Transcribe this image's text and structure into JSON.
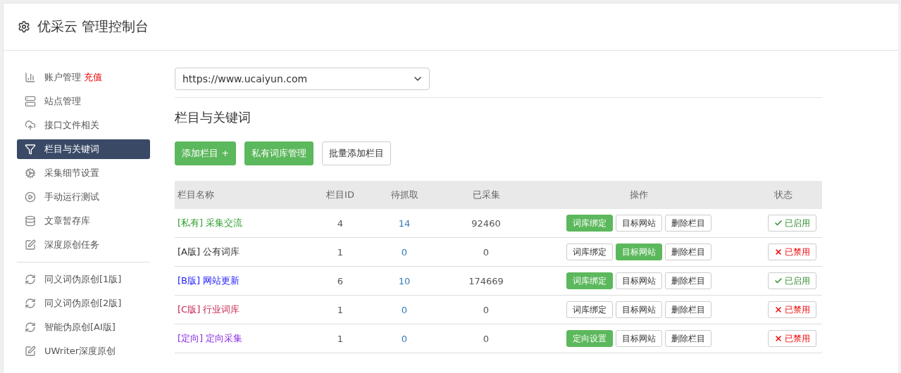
{
  "header": {
    "title": "优采云 管理控制台"
  },
  "sidebar": {
    "groups": [
      {
        "items": [
          {
            "kind": "chart",
            "label": "账户管理",
            "badge": "充值",
            "selected": false
          },
          {
            "kind": "server",
            "label": "站点管理",
            "selected": false
          },
          {
            "kind": "cloud",
            "label": "接口文件相关",
            "selected": false
          },
          {
            "kind": "filter",
            "label": "栏目与关键词",
            "selected": true
          },
          {
            "kind": "cogs",
            "label": "采集细节设置",
            "selected": false
          },
          {
            "kind": "play",
            "label": "手动运行测试",
            "selected": false
          },
          {
            "kind": "database",
            "label": "文章暂存库",
            "selected": false
          },
          {
            "kind": "edit",
            "label": "深度原创任务",
            "selected": false
          }
        ]
      },
      {
        "items": [
          {
            "kind": "refresh",
            "label": "同义词伪原创[1版]",
            "selected": false
          },
          {
            "kind": "refresh",
            "label": "同义词伪原创[2版]",
            "selected": false
          },
          {
            "kind": "refresh",
            "label": "智能伪原创[AI版]",
            "selected": false
          },
          {
            "kind": "edit",
            "label": "UWriter深度原创",
            "selected": false
          }
        ]
      }
    ]
  },
  "site_select": {
    "value": "https://www.ucaiyun.com"
  },
  "section_title": "栏目与关键词",
  "toolbar": [
    {
      "label": "添加栏目 +",
      "kind": "success"
    },
    {
      "label": "私有词库管理",
      "kind": "success"
    },
    {
      "label": "批量添加栏目",
      "kind": "default"
    }
  ],
  "table": {
    "columns": [
      "栏目名称",
      "栏目ID",
      "待抓取",
      "已采集",
      "操作",
      "状态"
    ],
    "rows": [
      {
        "name": "[私有] 采集交流",
        "color": "#2e9e2e",
        "id": "4",
        "pending": "14",
        "collected": "92460",
        "actions": [
          {
            "label": "词库绑定",
            "primary": true
          },
          {
            "label": "目标网站",
            "primary": false
          },
          {
            "label": "删除栏目",
            "primary": false
          }
        ],
        "status": {
          "label": "已启用",
          "enabled": true
        }
      },
      {
        "name": "[A版] 公有词库",
        "color": "#333333",
        "id": "1",
        "pending": "0",
        "collected": "0",
        "actions": [
          {
            "label": "词库绑定",
            "primary": false
          },
          {
            "label": "目标网站",
            "primary": true
          },
          {
            "label": "删除栏目",
            "primary": false
          }
        ],
        "status": {
          "label": "已禁用",
          "enabled": false
        }
      },
      {
        "name": "[B版] 网站更新",
        "color": "#1a1aff",
        "id": "6",
        "pending": "10",
        "collected": "174669",
        "actions": [
          {
            "label": "词库绑定",
            "primary": true
          },
          {
            "label": "目标网站",
            "primary": false
          },
          {
            "label": "删除栏目",
            "primary": false
          }
        ],
        "status": {
          "label": "已启用",
          "enabled": true
        }
      },
      {
        "name": "[C版] 行业词库",
        "color": "#c7254e",
        "id": "1",
        "pending": "0",
        "collected": "0",
        "actions": [
          {
            "label": "词库绑定",
            "primary": false
          },
          {
            "label": "目标网站",
            "primary": false
          },
          {
            "label": "删除栏目",
            "primary": false
          }
        ],
        "status": {
          "label": "已禁用",
          "enabled": false
        }
      },
      {
        "name": "[定向] 定向采集",
        "color": "#8a2be2",
        "id": "1",
        "pending": "0",
        "collected": "0",
        "actions": [
          {
            "label": "定向设置",
            "primary": true
          },
          {
            "label": "目标网站",
            "primary": false
          },
          {
            "label": "删除栏目",
            "primary": false
          }
        ],
        "status": {
          "label": "已禁用",
          "enabled": false
        }
      }
    ]
  }
}
